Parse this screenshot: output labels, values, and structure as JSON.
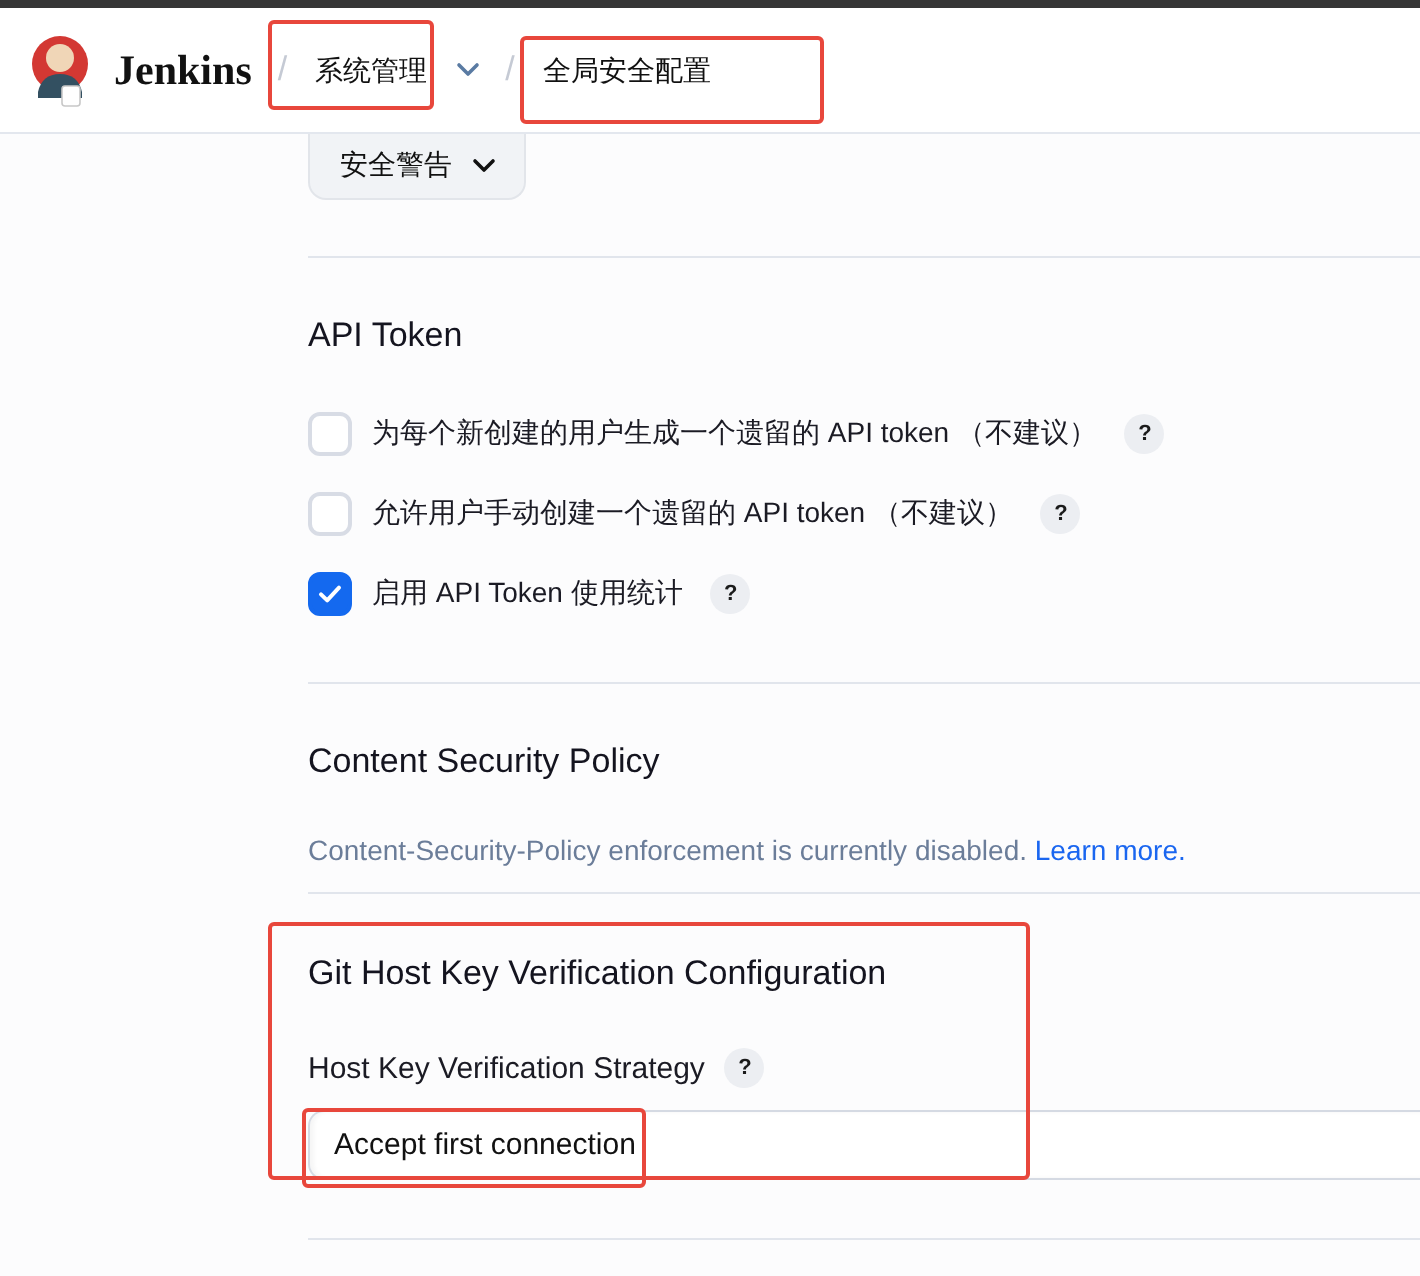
{
  "header": {
    "brand": "Jenkins",
    "breadcrumbs": [
      {
        "separator": "/",
        "label": "系统管理",
        "dropdown": true,
        "highlighted": true
      },
      {
        "separator": "/",
        "label": "全局安全配置",
        "dropdown": false,
        "highlighted": true
      }
    ]
  },
  "jump_menu": {
    "label": "安全警告"
  },
  "sections": [
    {
      "kind": "checkboxes",
      "title": "API Token",
      "highlighted": false,
      "options": [
        {
          "label": "为每个新创建的用户生成一个遗留的 API token （不建议）",
          "checked": false,
          "help": "?"
        },
        {
          "label": "允许用户手动创建一个遗留的 API token （不建议）",
          "checked": false,
          "help": "?"
        },
        {
          "label": "启用 API Token 使用统计",
          "checked": true,
          "help": "?"
        }
      ]
    },
    {
      "kind": "notice",
      "title": "Content Security Policy",
      "highlighted": false,
      "text": "Content-Security-Policy enforcement is currently disabled.",
      "link": "Learn more."
    },
    {
      "kind": "select",
      "title": "Git Host Key Verification Configuration",
      "highlighted": true,
      "field": {
        "label": "Host Key Verification Strategy",
        "help": "?",
        "value": "Accept first connection",
        "highlighted": true
      }
    }
  ]
}
